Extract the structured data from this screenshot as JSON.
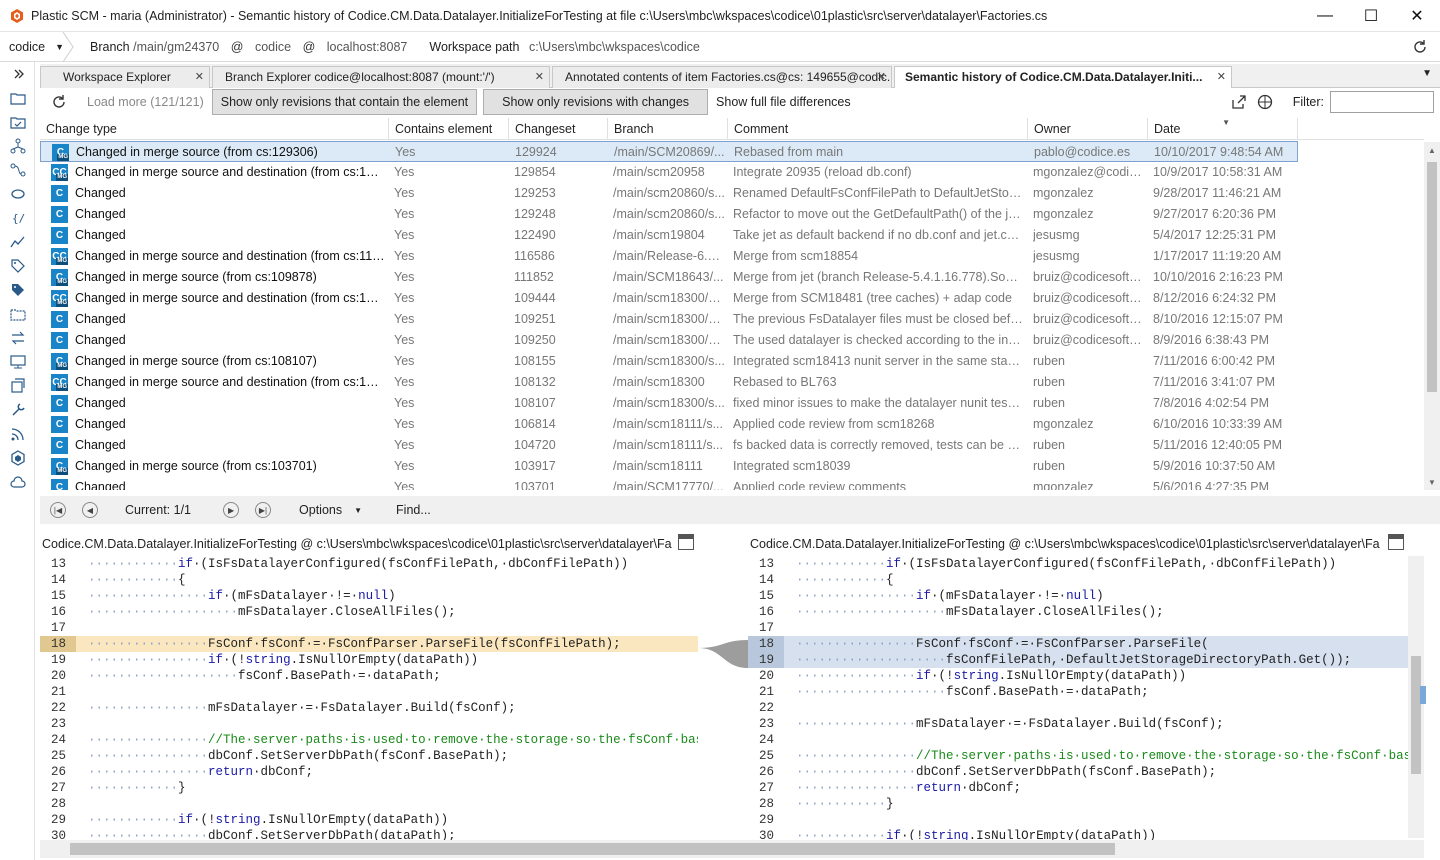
{
  "window": {
    "title": "Plastic SCM - maria (Administrator) - Semantic history of Codice.CM.Data.Datalayer.InitializeForTesting at file c:\\Users\\mbc\\wkspaces\\codice\\01plastic\\src\\server\\datalayer\\Factories.cs",
    "minimize": "—",
    "maximize": "☐",
    "close": "✕"
  },
  "branchbar": {
    "repo": "codice",
    "branch_label": "Branch",
    "branch_value": "/main/gm24370",
    "at1": "@",
    "repo_value": "codice",
    "at2": "@",
    "server_value": "localhost:8087",
    "workspace_label": "Workspace path",
    "workspace_value": "c:\\Users\\mbc\\wkspaces\\codice"
  },
  "tabs": [
    {
      "label": "Workspace Explorer",
      "close": "✕"
    },
    {
      "label": "Branch Explorer codice@localhost:8087 (mount:'/')",
      "close": "✕"
    },
    {
      "label": "Annotated contents of item Factories.cs@cs: 149655@codic...",
      "close": "✕"
    },
    {
      "label": "Semantic history of Codice.CM.Data.Datalayer.Initi...",
      "close": "✕"
    }
  ],
  "toolbar": {
    "load_more": "Load more (121/121)",
    "btn_contain": "Show only revisions that contain the element",
    "btn_changes": "Show only revisions with changes",
    "btn_full": "Show full file differences",
    "filter_label": "Filter:",
    "filter_value": ""
  },
  "grid": {
    "headers": [
      "Change type",
      "Contains element",
      "Changeset",
      "Branch",
      "Comment",
      "Owner",
      "Date"
    ],
    "rows": [
      {
        "icon": "CM",
        "type": "Changed in merge source (from cs:129306)",
        "contains": "Yes",
        "cs": "129924",
        "branch": "/main/SCM20869/...",
        "comment": "Rebased from main",
        "owner": "pablo@codice.es",
        "date": "10/10/2017 9:48:54 AM"
      },
      {
        "icon": "CCM",
        "type": "Changed in merge source and destination (from cs:1298...",
        "contains": "Yes",
        "cs": "129854",
        "branch": "/main/scm20958",
        "comment": "Integrate 20935 (reload db.conf)",
        "owner": "mgonzalez@codic...",
        "date": "10/9/2017 10:58:31 AM"
      },
      {
        "icon": "C",
        "type": "Changed",
        "contains": "Yes",
        "cs": "129253",
        "branch": "/main/scm20860/s...",
        "comment": "Renamed DefaultFsConfFilePath to DefaultJetStorage...",
        "owner": "mgonzalez",
        "date": "9/28/2017 11:46:21 AM"
      },
      {
        "icon": "C",
        "type": "Changed",
        "contains": "Yes",
        "cs": "129248",
        "branch": "/main/scm20860/s...",
        "comment": "Refactor to move out the GetDefaultPath() of the jet.c...",
        "owner": "mgonzalez",
        "date": "9/27/2017 6:20:36 PM"
      },
      {
        "icon": "C",
        "type": "Changed",
        "contains": "Yes",
        "cs": "122490",
        "branch": "/main/scm19804",
        "comment": "Take jet as default backend if no db.conf and jet.conf ...",
        "owner": "jesusmg",
        "date": "5/4/2017 12:25:31 PM"
      },
      {
        "icon": "CCM",
        "type": "Changed in merge source and destination (from cs:1158...",
        "contains": "Yes",
        "cs": "116586",
        "branch": "/main/Release-6.0....",
        "comment": "Merge from scm18854",
        "owner": "jesusmg",
        "date": "1/17/2017 11:19:20 AM"
      },
      {
        "icon": "CM",
        "type": "Changed in merge source (from cs:109878)",
        "contains": "Yes",
        "cs": "111852",
        "branch": "/main/SCM18643/...",
        "comment": "Merge from jet (branch Release-5.4.1.16.778).Some m...",
        "owner": "bruiz@codicesoftw...",
        "date": "10/10/2016 2:16:23 PM"
      },
      {
        "icon": "CCM",
        "type": "Changed in merge source and destination (from cs:1092...",
        "contains": "Yes",
        "cs": "109444",
        "branch": "/main/scm18300/S...",
        "comment": "Merge from SCM18481 (tree caches) + adap code",
        "owner": "bruiz@codicesoftw...",
        "date": "8/12/2016 6:24:32 PM"
      },
      {
        "icon": "C",
        "type": "Changed",
        "contains": "Yes",
        "cs": "109251",
        "branch": "/main/scm18300/S...",
        "comment": "The previous FsDatalayer files must be closed before ...",
        "owner": "bruiz@codicesoftw...",
        "date": "8/10/2016 12:15:07 PM"
      },
      {
        "icon": "C",
        "type": "Changed",
        "contains": "Yes",
        "cs": "109250",
        "branch": "/main/scm18300/S...",
        "comment": "The used datalayer is checked according to the initiali...",
        "owner": "bruiz@codicesoftw...",
        "date": "8/9/2016 6:38:43 PM"
      },
      {
        "icon": "CM",
        "type": "Changed in merge source (from cs:108107)",
        "contains": "Yes",
        "cs": "108155",
        "branch": "/main/scm18300/s...",
        "comment": "Integrated scm18413 nunit server in the same status t...",
        "owner": "ruben",
        "date": "7/11/2016 6:00:42 PM"
      },
      {
        "icon": "CCM",
        "type": "Changed in merge source and destination (from cs:1074...",
        "contains": "Yes",
        "cs": "108132",
        "branch": "/main/scm18300",
        "comment": "Rebased to BL763",
        "owner": "ruben",
        "date": "7/11/2016 3:41:07 PM"
      },
      {
        "icon": "C",
        "type": "Changed",
        "contains": "Yes",
        "cs": "108107",
        "branch": "/main/scm18300/s...",
        "comment": "fixed minor issues to make the datalayer nunit tests r...",
        "owner": "ruben",
        "date": "7/8/2016 4:02:54 PM"
      },
      {
        "icon": "C",
        "type": "Changed",
        "contains": "Yes",
        "cs": "106814",
        "branch": "/main/scm18111/s...",
        "comment": "Applied code review from scm18268",
        "owner": "mgonzalez",
        "date": "6/10/2016 10:33:39 AM"
      },
      {
        "icon": "C",
        "type": "Changed",
        "contains": "Yes",
        "cs": "104720",
        "branch": "/main/scm18111/s...",
        "comment": "fs backed data is correctly removed, tests can be rerun",
        "owner": "ruben",
        "date": "5/11/2016 12:40:05 PM"
      },
      {
        "icon": "CM",
        "type": "Changed in merge source (from cs:103701)",
        "contains": "Yes",
        "cs": "103917",
        "branch": "/main/scm18111",
        "comment": "Integrated scm18039",
        "owner": "ruben",
        "date": "5/9/2016 10:37:50 AM"
      },
      {
        "icon": "C",
        "type": "Changed",
        "contains": "Yes",
        "cs": "103701",
        "branch": "/main/SCM17770/...",
        "comment": "Applied code review comments",
        "owner": "mgonzalez",
        "date": "5/6/2016 4:27:35 PM"
      }
    ]
  },
  "navbar": {
    "current": "Current: 1/1",
    "options": "Options",
    "find": "Find..."
  },
  "left_pane": {
    "title": "Codice.CM.Data.Datalayer.InitializeForTesting @ c:\\Users\\mbc\\wkspaces\\codice\\01plastic\\src\\server\\datalayer\\Factori...",
    "lines": [
      {
        "n": "13",
        "t": "············if·(IsFsDatalayerConfigured(fsConfFilePath,·dbConfFilePath))"
      },
      {
        "n": "14",
        "t": "············{"
      },
      {
        "n": "15",
        "t": "················if·(mFsDatalayer·!=·null)"
      },
      {
        "n": "16",
        "t": "····················mFsDatalayer.CloseAllFiles();"
      },
      {
        "n": "17",
        "t": ""
      },
      {
        "n": "18",
        "t": "················FsConf·fsConf·=·FsConfParser.ParseFile(fsConfFilePath);"
      },
      {
        "n": "19",
        "t": "················if·(!string.IsNullOrEmpty(dataPath))"
      },
      {
        "n": "20",
        "t": "····················fsConf.BasePath·=·dataPath;"
      },
      {
        "n": "21",
        "t": ""
      },
      {
        "n": "22",
        "t": "················mFsDatalayer·=·FsDatalayer.Build(fsConf);"
      },
      {
        "n": "23",
        "t": ""
      },
      {
        "n": "24",
        "t": "················//The·server·paths·is·used·to·remove·the·storage·so·the·fsConf·base·pat"
      },
      {
        "n": "25",
        "t": "················dbConf.SetServerDbPath(fsConf.BasePath);"
      },
      {
        "n": "26",
        "t": "················return·dbConf;"
      },
      {
        "n": "27",
        "t": "············}"
      },
      {
        "n": "28",
        "t": ""
      },
      {
        "n": "29",
        "t": "············if·(!string.IsNullOrEmpty(dataPath))"
      },
      {
        "n": "30",
        "t": "················dbConf.SetServerDbPath(dataPath);"
      }
    ]
  },
  "right_pane": {
    "title": "Codice.CM.Data.Datalayer.InitializeForTesting @ c:\\Users\\mbc\\wkspaces\\codice\\01plastic\\src\\server\\datalayer\\Factori...",
    "lines": [
      {
        "n": "13",
        "t": "············if·(IsFsDatalayerConfigured(fsConfFilePath,·dbConfFilePath))"
      },
      {
        "n": "14",
        "t": "············{"
      },
      {
        "n": "15",
        "t": "················if·(mFsDatalayer·!=·null)"
      },
      {
        "n": "16",
        "t": "····················mFsDatalayer.CloseAllFiles();"
      },
      {
        "n": "17",
        "t": ""
      },
      {
        "n": "18",
        "t": "················FsConf·fsConf·=·FsConfParser.ParseFile("
      },
      {
        "n": "19",
        "t": "····················fsConfFilePath,·DefaultJetStorageDirectoryPath.Get());"
      },
      {
        "n": "20",
        "t": "················if·(!string.IsNullOrEmpty(dataPath))"
      },
      {
        "n": "21",
        "t": "····················fsConf.BasePath·=·dataPath;"
      },
      {
        "n": "22",
        "t": ""
      },
      {
        "n": "23",
        "t": "················mFsDatalayer·=·FsDatalayer.Build(fsConf);"
      },
      {
        "n": "24",
        "t": ""
      },
      {
        "n": "25",
        "t": "················//The·server·paths·is·used·to·remove·the·storage·so·the·fsConf·base·pat"
      },
      {
        "n": "26",
        "t": "················dbConf.SetServerDbPath(fsConf.BasePath);"
      },
      {
        "n": "27",
        "t": "················return·dbConf;"
      },
      {
        "n": "28",
        "t": "············}"
      },
      {
        "n": "29",
        "t": ""
      },
      {
        "n": "30",
        "t": "············if·(!string.IsNullOrEmpty(dataPath))"
      }
    ]
  },
  "colors": {
    "accent": "#1a84c8",
    "highlight_yellow": "#fbe7bf",
    "highlight_blue": "#d6e0ef"
  }
}
